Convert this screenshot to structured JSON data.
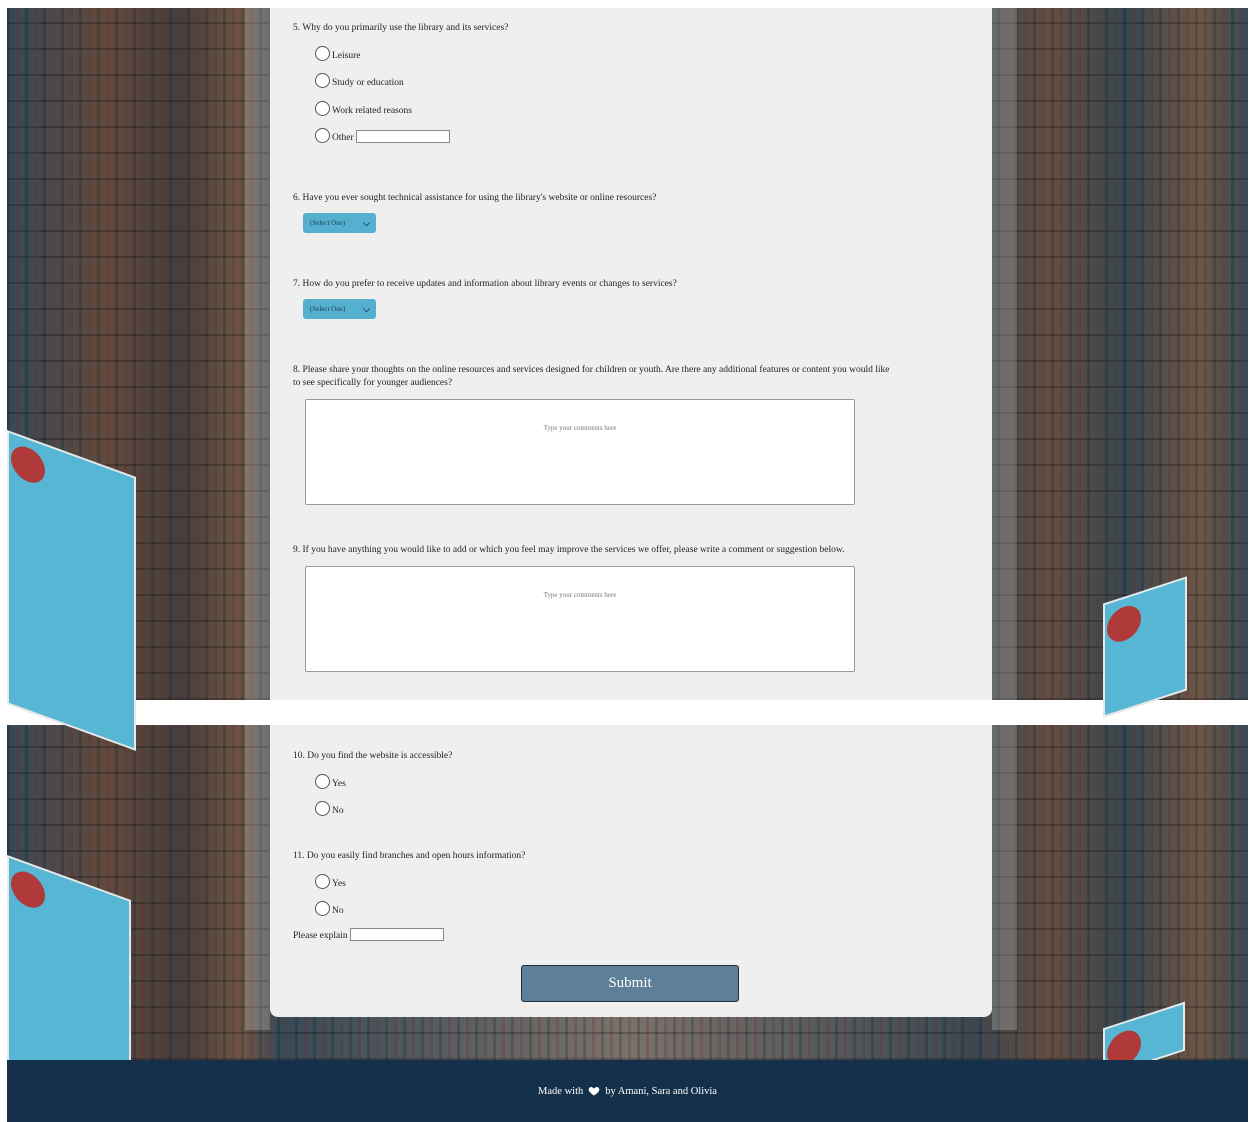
{
  "top_section": {
    "q5": {
      "question": "5. Why do you primarily use the library and its services?",
      "options": [
        "Leisure",
        "Study or education",
        "Work related reasons",
        "Other"
      ]
    },
    "q6": {
      "question": "6. Have you ever sought technical assistance for using the library's website or online resources?",
      "select_value": "(Select One)"
    },
    "q7": {
      "question": "7. How do you prefer to receive updates and information about library events or changes to services?",
      "select_value": "(Select One)"
    },
    "q8": {
      "question_line1": "8. Please share your thoughts on the online resources and services designed for children or youth. Are there any additional features or content you would like",
      "question_line2": "to see specifically for younger audiences?",
      "placeholder": "Type your comments here"
    },
    "q9": {
      "question": "9. If you have anything you would like to add or which you feel may improve the services we offer, please write a comment or suggestion below.",
      "placeholder": "Type your comments here"
    }
  },
  "bottom_section": {
    "q10": {
      "question": "10. Do you find the website is accessible?",
      "options": [
        "Yes",
        "No"
      ]
    },
    "q11": {
      "question": "11. Do you easily find branches and open hours information?",
      "options": [
        "Yes",
        "No"
      ],
      "explain_label": "Please explain"
    },
    "submit_label": "Submit"
  },
  "footer": {
    "made_with": "Made with",
    "credit": "by Amani, Sara and Olivia"
  },
  "colors": {
    "select_bg": "#55b0d0",
    "submit_bg": "#5e7f98",
    "footer_bg": "#14304a",
    "card_bg": "#efefef"
  }
}
